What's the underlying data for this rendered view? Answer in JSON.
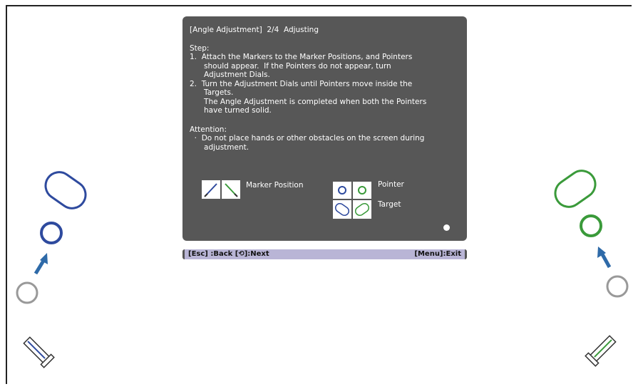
{
  "dialog": {
    "title": "[Angle Adjustment]  2/4  Adjusting",
    "step_heading": "Step:",
    "step_lines": [
      "1.  Attach the Markers to the Marker Positions, and Pointers",
      "      should appear.  If the Pointers do not appear, turn",
      "      Adjustment Dials.",
      "2.  Turn the Adjustment Dials until Pointers move inside the",
      "      Targets.",
      "      The Angle Adjustment is completed when both the Pointers",
      "      have turned solid."
    ],
    "attention_heading": "Attention:",
    "attention_lines": [
      "  ·  Do not place hands or other obstacles on the screen during",
      "      adjustment."
    ],
    "legend": {
      "marker_position": "Marker Position",
      "pointer": "Pointer",
      "target": "Target"
    }
  },
  "footer": {
    "left": "[Esc] :Back  [⟲]:Next",
    "right": "[Menu]:Exit"
  },
  "colors": {
    "blue": "#2e4a9e",
    "green": "#3a9a3a",
    "gray": "#999999",
    "arrow": "#2e6aa8"
  },
  "icons": [
    "marker-icon",
    "pointer-icon",
    "target-icon",
    "arrow-up-icon"
  ]
}
